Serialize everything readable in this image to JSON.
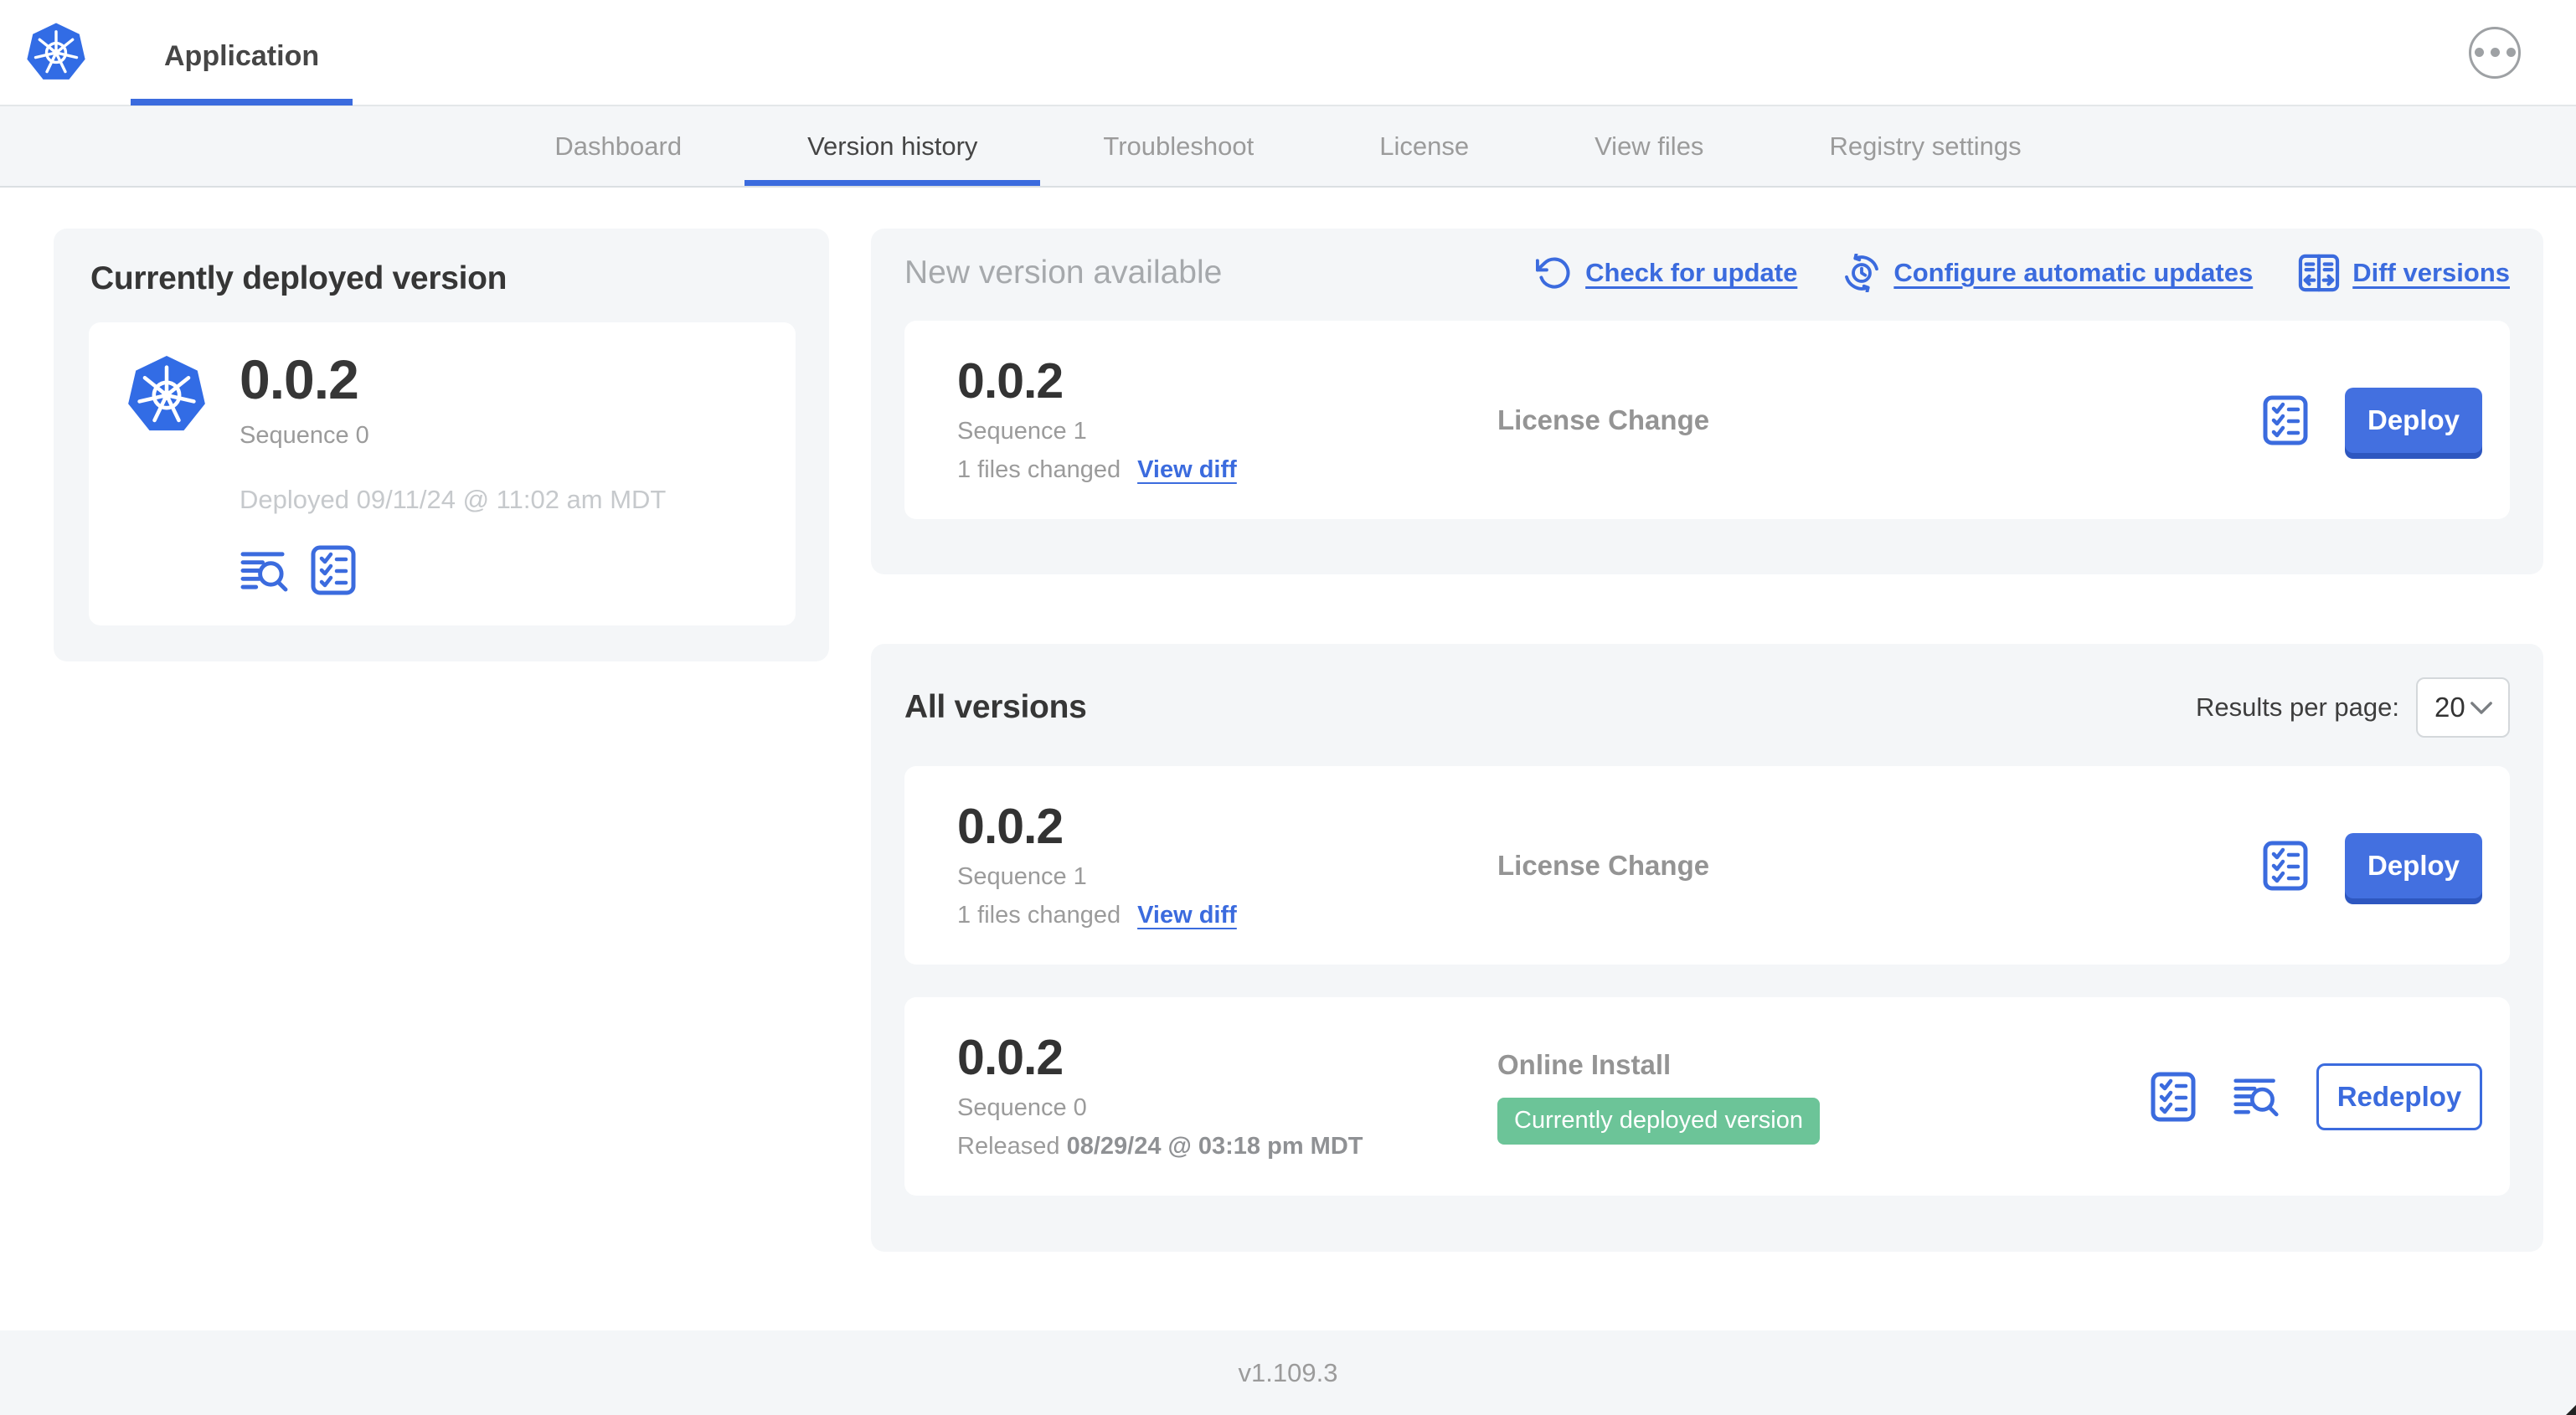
{
  "header": {
    "app_title": "Application"
  },
  "nav": {
    "tabs": [
      {
        "label": "Dashboard"
      },
      {
        "label": "Version history"
      },
      {
        "label": "Troubleshoot"
      },
      {
        "label": "License"
      },
      {
        "label": "View files"
      },
      {
        "label": "Registry settings"
      }
    ]
  },
  "current": {
    "title": "Currently deployed version",
    "version": "0.0.2",
    "sequence": "Sequence 0",
    "deployed": "Deployed 09/11/24 @ 11:02 am MDT"
  },
  "newver": {
    "title": "New version available",
    "actions": [
      {
        "label": "Check for update",
        "icon": "refresh-icon"
      },
      {
        "label": "Configure automatic updates",
        "icon": "schedule-icon"
      },
      {
        "label": "Diff versions",
        "icon": "diff-icon"
      }
    ],
    "row": {
      "version": "0.0.2",
      "sequence": "Sequence 1",
      "files_changed": "1 files changed",
      "view_diff": "View diff",
      "source": "License Change",
      "action": "Deploy"
    }
  },
  "all": {
    "title": "All versions",
    "results_label": "Results per page:",
    "results_value": "20",
    "rows": [
      {
        "version": "0.0.2",
        "sequence": "Sequence 1",
        "files_changed": "1 files changed",
        "view_diff": "View diff",
        "source": "License Change",
        "action": "Deploy"
      },
      {
        "version": "0.0.2",
        "sequence": "Sequence 0",
        "released_prefix": "Released ",
        "released_date": "08/29/24 @ 03:18 pm MDT",
        "source": "Online Install",
        "badge": "Currently deployed version",
        "action": "Redeploy"
      }
    ]
  },
  "footer": {
    "version": "v1.109.3"
  },
  "colors": {
    "accent_blue": "#3B6BDE",
    "logo_blue": "#326CE5",
    "badge_green": "#6CC498",
    "panel_gray": "#F4F6F8"
  }
}
